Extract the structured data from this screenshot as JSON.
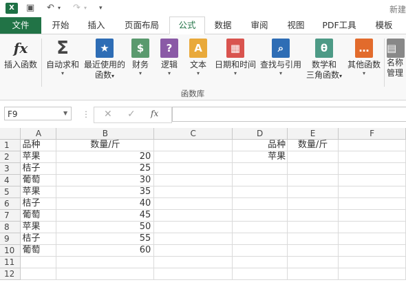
{
  "title": "新建",
  "quick_access": {
    "undo": "↶",
    "redo": "↷"
  },
  "tabs": [
    "文件",
    "开始",
    "插入",
    "页面布局",
    "公式",
    "数据",
    "审阅",
    "视图",
    "PDF工具",
    "模板"
  ],
  "ribbon": {
    "buttons": [
      {
        "label": "插入函数",
        "line2": "",
        "icon": "fx",
        "color": "transparent"
      },
      {
        "label": "自动求和",
        "line2": "",
        "icon": "Σ",
        "color": "transparent"
      },
      {
        "label": "最近使用的",
        "line2": "函数",
        "icon": "★",
        "color": "#2e6db5"
      },
      {
        "label": "财务",
        "line2": "",
        "icon": "$",
        "color": "#5a9a6e"
      },
      {
        "label": "逻辑",
        "line2": "",
        "icon": "?",
        "color": "#8a5aa6"
      },
      {
        "label": "文本",
        "line2": "",
        "icon": "A",
        "color": "#e9a93a"
      },
      {
        "label": "日期和时间",
        "line2": "",
        "icon": "▦",
        "color": "#d9544f"
      },
      {
        "label": "查找与引用",
        "line2": "",
        "icon": "⌕",
        "color": "#2e6db5"
      },
      {
        "label": "数学和",
        "line2": "三角函数",
        "icon": "θ",
        "color": "#4d9a86"
      },
      {
        "label": "其他函数",
        "line2": "",
        "icon": "…",
        "color": "#e26b2c"
      },
      {
        "label": "名称",
        "line2": "管理",
        "icon": "▤",
        "color": "#888888"
      }
    ],
    "group_label": "函数库"
  },
  "formula_bar": {
    "name_box": "F9",
    "cancel": "✕",
    "enter": "✓",
    "fx": "fx",
    "formula": ""
  },
  "columns": [
    "A",
    "B",
    "C",
    "D",
    "E",
    "F"
  ],
  "rows": [
    {
      "n": "1",
      "A": "品种",
      "B": "数量/斤",
      "C": "",
      "D": "品种",
      "E": "数量/斤",
      "F": ""
    },
    {
      "n": "2",
      "A": "苹果",
      "B": "20",
      "C": "",
      "D": "苹果",
      "E": "",
      "F": ""
    },
    {
      "n": "3",
      "A": "桔子",
      "B": "25",
      "C": "",
      "D": "",
      "E": "",
      "F": ""
    },
    {
      "n": "4",
      "A": "葡萄",
      "B": "30",
      "C": "",
      "D": "",
      "E": "",
      "F": ""
    },
    {
      "n": "5",
      "A": "苹果",
      "B": "35",
      "C": "",
      "D": "",
      "E": "",
      "F": ""
    },
    {
      "n": "6",
      "A": "桔子",
      "B": "40",
      "C": "",
      "D": "",
      "E": "",
      "F": ""
    },
    {
      "n": "7",
      "A": "葡萄",
      "B": "45",
      "C": "",
      "D": "",
      "E": "",
      "F": ""
    },
    {
      "n": "8",
      "A": "苹果",
      "B": "50",
      "C": "",
      "D": "",
      "E": "",
      "F": ""
    },
    {
      "n": "9",
      "A": "桔子",
      "B": "55",
      "C": "",
      "D": "",
      "E": "",
      "F": ""
    },
    {
      "n": "10",
      "A": "葡萄",
      "B": "60",
      "C": "",
      "D": "",
      "E": "",
      "F": ""
    },
    {
      "n": "11",
      "A": "",
      "B": "",
      "C": "",
      "D": "",
      "E": "",
      "F": ""
    },
    {
      "n": "12",
      "A": "",
      "B": "",
      "C": "",
      "D": "",
      "E": "",
      "F": ""
    }
  ]
}
